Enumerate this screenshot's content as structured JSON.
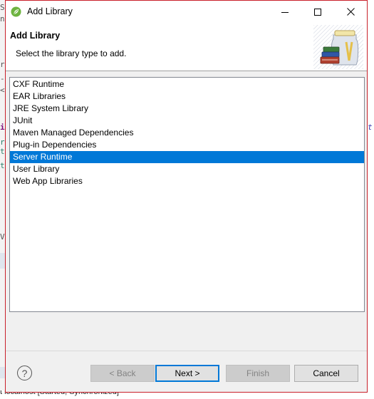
{
  "window": {
    "title": "Add Library"
  },
  "header": {
    "title": "Add Library",
    "description": "Select the library type to add."
  },
  "library_types": [
    {
      "label": "CXF Runtime",
      "selected": false
    },
    {
      "label": "EAR Libraries",
      "selected": false
    },
    {
      "label": "JRE System Library",
      "selected": false
    },
    {
      "label": "JUnit",
      "selected": false
    },
    {
      "label": "Maven Managed Dependencies",
      "selected": false
    },
    {
      "label": "Plug-in Dependencies",
      "selected": false
    },
    {
      "label": "Server Runtime",
      "selected": true
    },
    {
      "label": "User Library",
      "selected": false
    },
    {
      "label": "Web App Libraries",
      "selected": false
    }
  ],
  "buttons": {
    "help": "?",
    "back": "< Back",
    "next": "Next >",
    "finish": "Finish",
    "cancel": "Cancel"
  },
  "background": {
    "status_text": "t localhost  [Started, Synchronized]"
  },
  "colors": {
    "selection": "#0078d7",
    "window_border": "#c9202a",
    "spring_green": "#6db33f"
  },
  "icons": {
    "app": "spring-leaf-icon",
    "minimize": "minimize-icon",
    "maximize": "maximize-icon",
    "close": "close-icon",
    "banner": "library-jar-books-icon",
    "help": "help-icon"
  }
}
